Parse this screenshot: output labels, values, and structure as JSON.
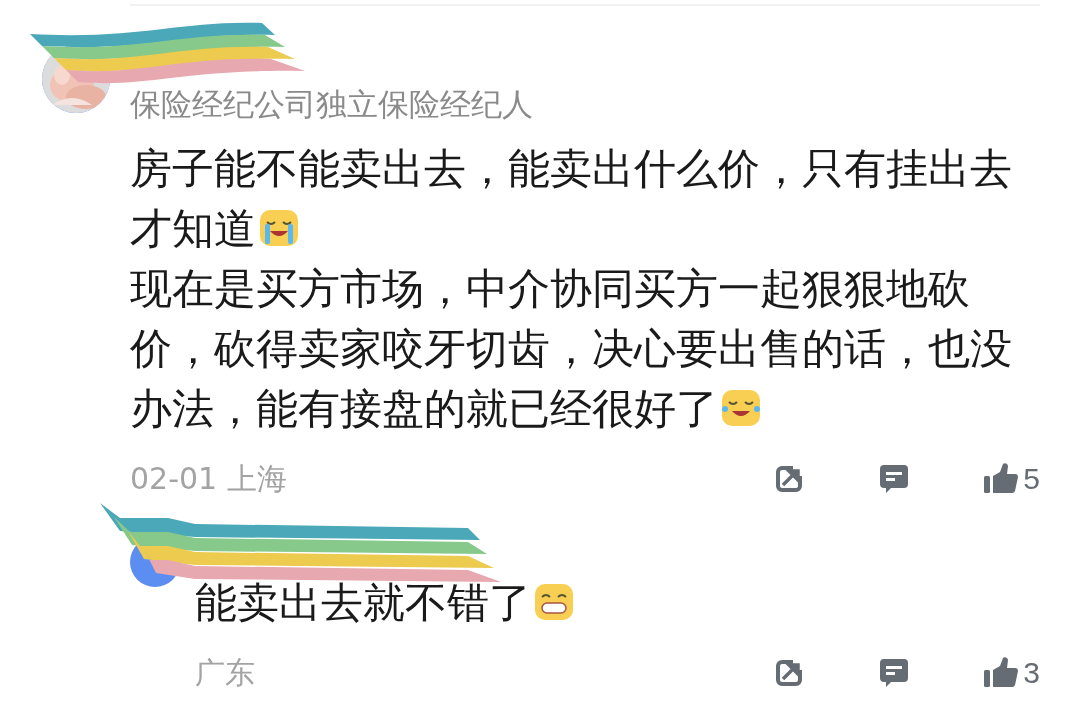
{
  "comment": {
    "subtitle": "保险经纪公司独立保险经纪人",
    "paragraphs": [
      [
        {
          "text": "房子能不能卖出去，能卖出什么价，只有挂出去才知道"
        },
        {
          "kind": "crying"
        }
      ],
      [
        {
          "text": "现在是买方市场，中介协同买方一起狠狠地砍价，砍得卖家咬牙切齿，决心要出售的话，也没办法，能有接盘的就已经很好了"
        },
        {
          "kind": "laughing"
        }
      ]
    ],
    "meta": "02-01 上海",
    "likes": "5"
  },
  "reply": {
    "paragraphs": [
      [
        {
          "text": "能卖出去就不错了"
        },
        {
          "kind": "grinning"
        }
      ]
    ],
    "meta": "广东",
    "likes": "3"
  }
}
